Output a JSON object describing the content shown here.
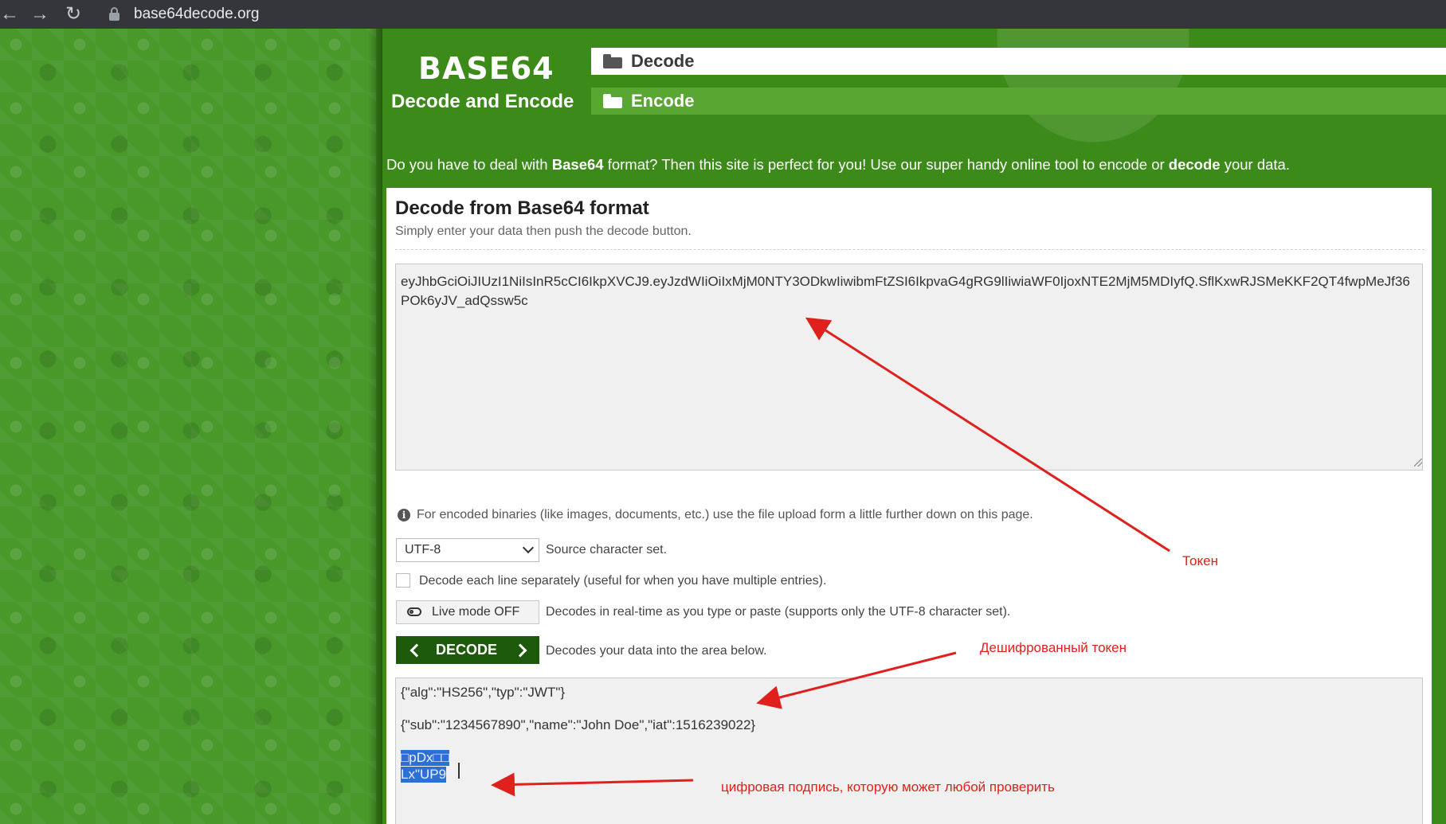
{
  "browser": {
    "url": "base64decode.org",
    "back_icon": "arrow-left-icon",
    "forward_icon": "arrow-right-icon",
    "reload_icon": "reload-icon"
  },
  "header": {
    "logo_title": "BASE64",
    "logo_subtitle": "Decode and Encode",
    "tabs": [
      {
        "label": "Decode",
        "icon": "folder-open-icon",
        "active": true
      },
      {
        "label": "Encode",
        "icon": "folder-icon",
        "active": false
      }
    ]
  },
  "intro": {
    "part1": "Do you have to deal with ",
    "bold1": "Base64",
    "part2": " format? Then this site is perfect for you! Use our super handy online tool to encode or ",
    "bold2": "decode",
    "part3": " your data."
  },
  "card": {
    "title": "Decode from Base64 format",
    "subtitle": "Simply enter your data then push the decode button.",
    "input_value": "eyJhbGciOiJIUzI1NiIsInR5cCI6IkpXVCJ9.eyJzdWIiOiIxMjM0NTY3ODkwIiwibmFtZSI6IkpvaG4gRG9lIiwiaWF0IjoxNTE2MjM5MDIyfQ.SflKxwRJSMeKKF2QT4fwpMeJf36POk6yJV_adQssw5c",
    "info_text": "For encoded binaries (like images, documents, etc.) use the file upload form a little further down on this page.",
    "charset_value": "UTF-8",
    "charset_label": "Source character set.",
    "checkbox_label": "Decode each line separately (useful for when you have multiple entries).",
    "live_label": "Live mode OFF",
    "live_desc": "Decodes in real-time as you type or paste (supports only the UTF-8 character set).",
    "decode_label": "DECODE",
    "decode_desc": "Decodes your data into the area below.",
    "output_lines": [
      "{\"alg\":\"HS256\",\"typ\":\"JWT\"}",
      "{\"sub\":\"1234567890\",\"name\":\"John Doe\",\"iat\":1516239022}",
      "□pDx□□",
      "Lx\"UP9"
    ]
  },
  "annotations": {
    "token": "Токен",
    "decoded_token": "Дешифрованный токен",
    "signature": "цифровая подпись, которую может любой проверить"
  },
  "colors": {
    "site_green": "#3c8a1a",
    "decode_button": "#1e5a0b",
    "annotation_red": "#e0201c",
    "selection_blue": "#2e6fd6"
  }
}
